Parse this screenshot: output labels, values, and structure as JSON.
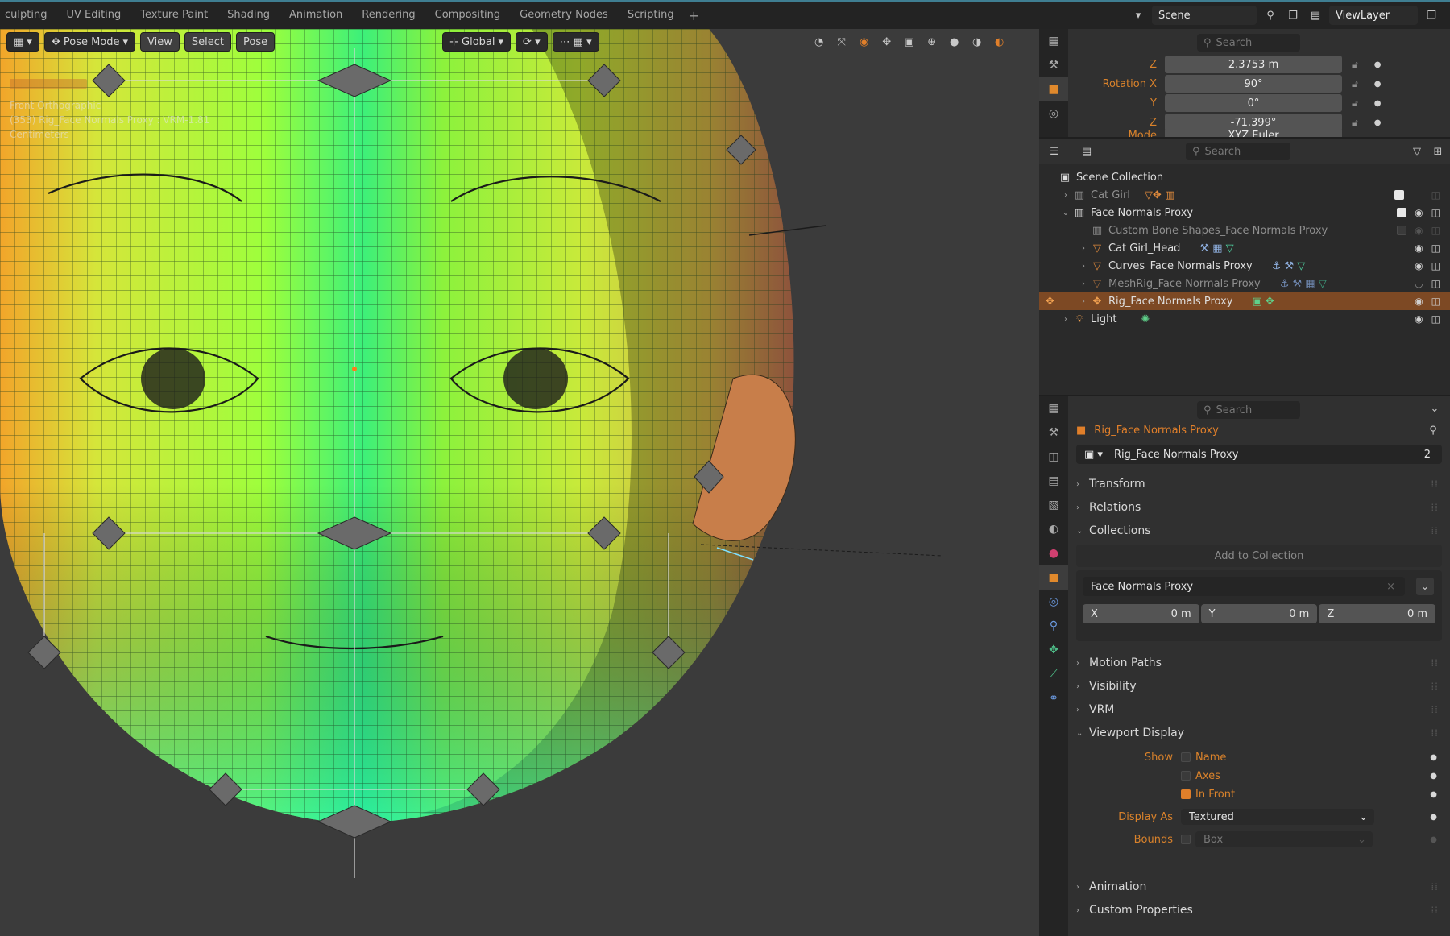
{
  "workspace_tabs": [
    "culpting",
    "UV Editing",
    "Texture Paint",
    "Shading",
    "Animation",
    "Rendering",
    "Compositing",
    "Geometry Nodes",
    "Scripting"
  ],
  "add_tab_label": "+",
  "scene_selector": {
    "label": "Scene"
  },
  "viewlayer_selector": {
    "label": "ViewLayer"
  },
  "viewport": {
    "mode_label": "Pose Mode",
    "menus": [
      "View",
      "Select",
      "Pose"
    ],
    "orientation_label": "Global",
    "overlay_text": {
      "view_name": "Front Orthographic",
      "object_info": "(353) Rig_Face Normals Proxy : VRM-1.81",
      "units": "Centimeters"
    }
  },
  "properties_top": {
    "search_placeholder": "Search",
    "rows": [
      {
        "label": "Z",
        "value": "2.3753 m"
      },
      {
        "label": "Rotation X",
        "value": "90°"
      },
      {
        "label": "Y",
        "value": "0°"
      },
      {
        "label": "Z",
        "value": "-71.399°"
      },
      {
        "label": "Mode",
        "value": "XYZ Euler"
      }
    ]
  },
  "outliner": {
    "search_placeholder": "Search",
    "scene_collection_label": "Scene Collection",
    "items": [
      {
        "label": "Cat Girl",
        "dim": true
      },
      {
        "label": "Face Normals Proxy",
        "dim": false
      },
      {
        "label": "Custom Bone Shapes_Face Normals Proxy",
        "dim": true
      },
      {
        "label": "Cat Girl_Head",
        "dim": false
      },
      {
        "label": "Curves_Face Normals Proxy",
        "dim": false
      },
      {
        "label": "MeshRig_Face Normals Proxy",
        "dim": true
      },
      {
        "label": "Rig_Face Normals Proxy",
        "dim": false,
        "selected": true
      },
      {
        "label": "Light",
        "dim": false
      }
    ]
  },
  "properties": {
    "search_placeholder": "Search",
    "object_header": "Rig_Face Normals Proxy",
    "object_name_field": "Rig_Face Normals Proxy",
    "user_count": "2",
    "sections": {
      "transform": "Transform",
      "relations": "Relations",
      "collections": "Collections",
      "motion_paths": "Motion Paths",
      "visibility": "Visibility",
      "vrm": "VRM",
      "viewport_display": "Viewport Display",
      "animation": "Animation",
      "custom_properties": "Custom Properties"
    },
    "add_to_collection_label": "Add to Collection",
    "collection_name": "Face Normals Proxy",
    "offset": {
      "x_label": "X",
      "x_value": "0 m",
      "y_label": "Y",
      "y_value": "0 m",
      "z_label": "Z",
      "z_value": "0 m"
    },
    "viewport_display": {
      "show_label": "Show",
      "name_label": "Name",
      "name_checked": false,
      "axes_label": "Axes",
      "axes_checked": false,
      "in_front_label": "In Front",
      "in_front_checked": true,
      "display_as_label": "Display As",
      "display_as_value": "Textured",
      "bounds_label": "Bounds",
      "bounds_value": "Box",
      "bounds_checked": false
    }
  },
  "colors": {
    "accent": "#e07f2a",
    "selected_row": "#7d4924",
    "panel": "#303030",
    "viewport_bg": "#3b3b3b"
  }
}
